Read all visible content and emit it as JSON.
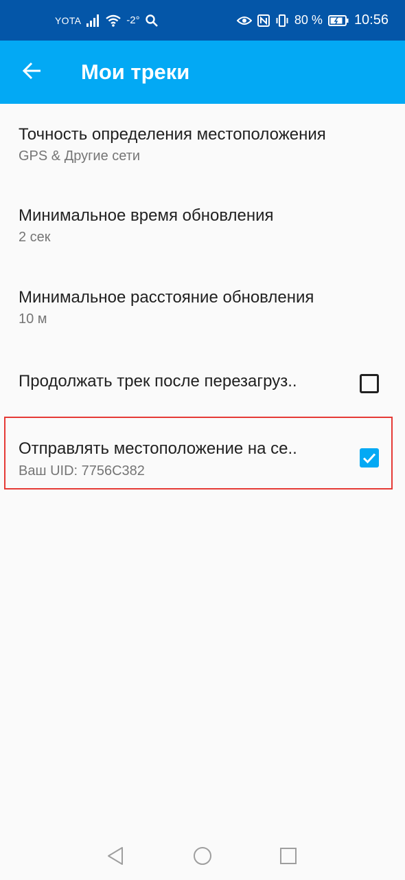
{
  "status_bar": {
    "carrier": "YOTA",
    "temperature": "-2°",
    "battery": "80 %",
    "time": "10:56",
    "icons": [
      "signal-icon",
      "wifi-icon",
      "search-icon",
      "eye-icon",
      "nfc-icon",
      "vibrate-icon",
      "battery-icon"
    ]
  },
  "app_bar": {
    "title": "Мои треки",
    "back_icon": "arrow-back-icon",
    "color": "#03a9f4"
  },
  "settings": [
    {
      "title": "Точность определения местоположения",
      "summary": "GPS & Другие сети"
    },
    {
      "title": "Минимальное время обновления",
      "summary": "2 сек"
    },
    {
      "title": "Минимальное расстояние обновления",
      "summary": "10 м"
    },
    {
      "title": "Продолжать трек после перезагруз..",
      "checked": false
    },
    {
      "title": "Отправлять местоположение на се..",
      "summary": "Ваш UID: 7756C382",
      "checked": true,
      "highlighted": true
    }
  ],
  "nav_bar": {
    "icons": [
      "nav-back-icon",
      "nav-home-icon",
      "nav-recent-icon"
    ]
  },
  "colors": {
    "status_bar": "#0456a8",
    "accent": "#03a9f4",
    "highlight": "#e53935"
  }
}
